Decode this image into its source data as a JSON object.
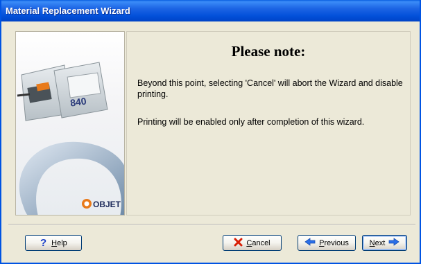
{
  "window": {
    "title": "Material Replacement Wizard"
  },
  "side_panel": {
    "product_image_label": "840",
    "logo_text": "OBJET"
  },
  "content": {
    "heading": "Please note:",
    "paragraph1": "Beyond this point, selecting 'Cancel' will abort the Wizard and disable printing.",
    "paragraph2": "Printing will be enabled only after completion of this wizard."
  },
  "buttons": {
    "help": {
      "first": "H",
      "rest": "elp",
      "icon": "question-mark-icon"
    },
    "cancel": {
      "first": "C",
      "rest": "ancel",
      "icon": "red-x-icon"
    },
    "previous": {
      "first": "P",
      "rest": "revious",
      "icon": "left-arrow-icon"
    },
    "next": {
      "first": "N",
      "rest": "ext",
      "icon": "right-arrow-icon"
    }
  },
  "colors": {
    "titlebar": "#0054e3",
    "dialog_bg": "#ece9d8",
    "help_icon": "#1a3fc8",
    "cancel_icon": "#d81e05",
    "arrow_icon": "#2a6ee8"
  }
}
